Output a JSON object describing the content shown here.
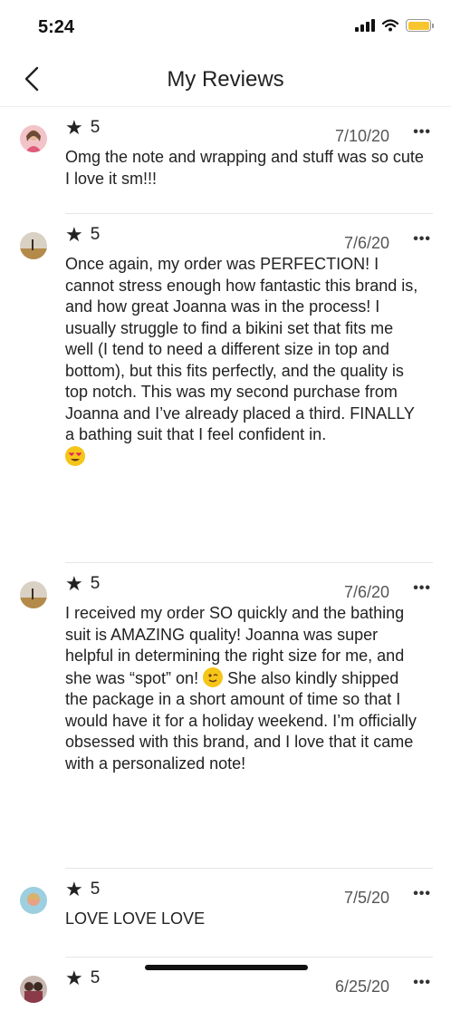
{
  "status": {
    "time": "5:24"
  },
  "nav": {
    "title": "My Reviews"
  },
  "reviews": [
    {
      "rating": "5",
      "date": "7/10/20",
      "text": "Omg the note and wrapping and stuff was so cute I love it sm!!!",
      "emoji": "",
      "avatar": "woman-pink-avatar"
    },
    {
      "rating": "5",
      "date": "7/6/20",
      "text": "Once again, my order was PERFECTION! I cannot stress enough how fantastic this brand is, and how great Joanna was in the process! I usually struggle to find a bikini set that fits me well (I tend to need a different size in top and bottom), but this fits perfectly, and the quality is top notch. This was my second purchase from Joanna and I’ve already placed a third. FINALLY a bathing suit that I feel confident in.",
      "emoji": "heart-eyes-emoji",
      "avatar": "field-avatar"
    },
    {
      "rating": "5",
      "date": "7/6/20",
      "text": "I received my order SO quickly and the bathing suit is AMAZING quality! Joanna was super helpful in determining the right size for me, and she was “spot” on!",
      "text2": "She also kindly shipped the package in a short amount of time so that I would have it for a holiday weekend. I’m officially obsessed with this brand, and I love that it came with a personalized note!",
      "emoji": "wink-emoji",
      "avatar": "field-avatar"
    },
    {
      "rating": "5",
      "date": "7/5/20",
      "text": "LOVE LOVE LOVE",
      "emoji": "",
      "avatar": "beach-avatar"
    },
    {
      "rating": "5",
      "date": "6/25/20",
      "text": "",
      "emoji": "",
      "avatar": "group-avatar"
    }
  ],
  "icons": {
    "star": "star-icon",
    "more": "more-icon",
    "back": "back-chevron-icon"
  },
  "colors": {
    "battery": "#f7c62f",
    "emoji": "#f5c518"
  }
}
